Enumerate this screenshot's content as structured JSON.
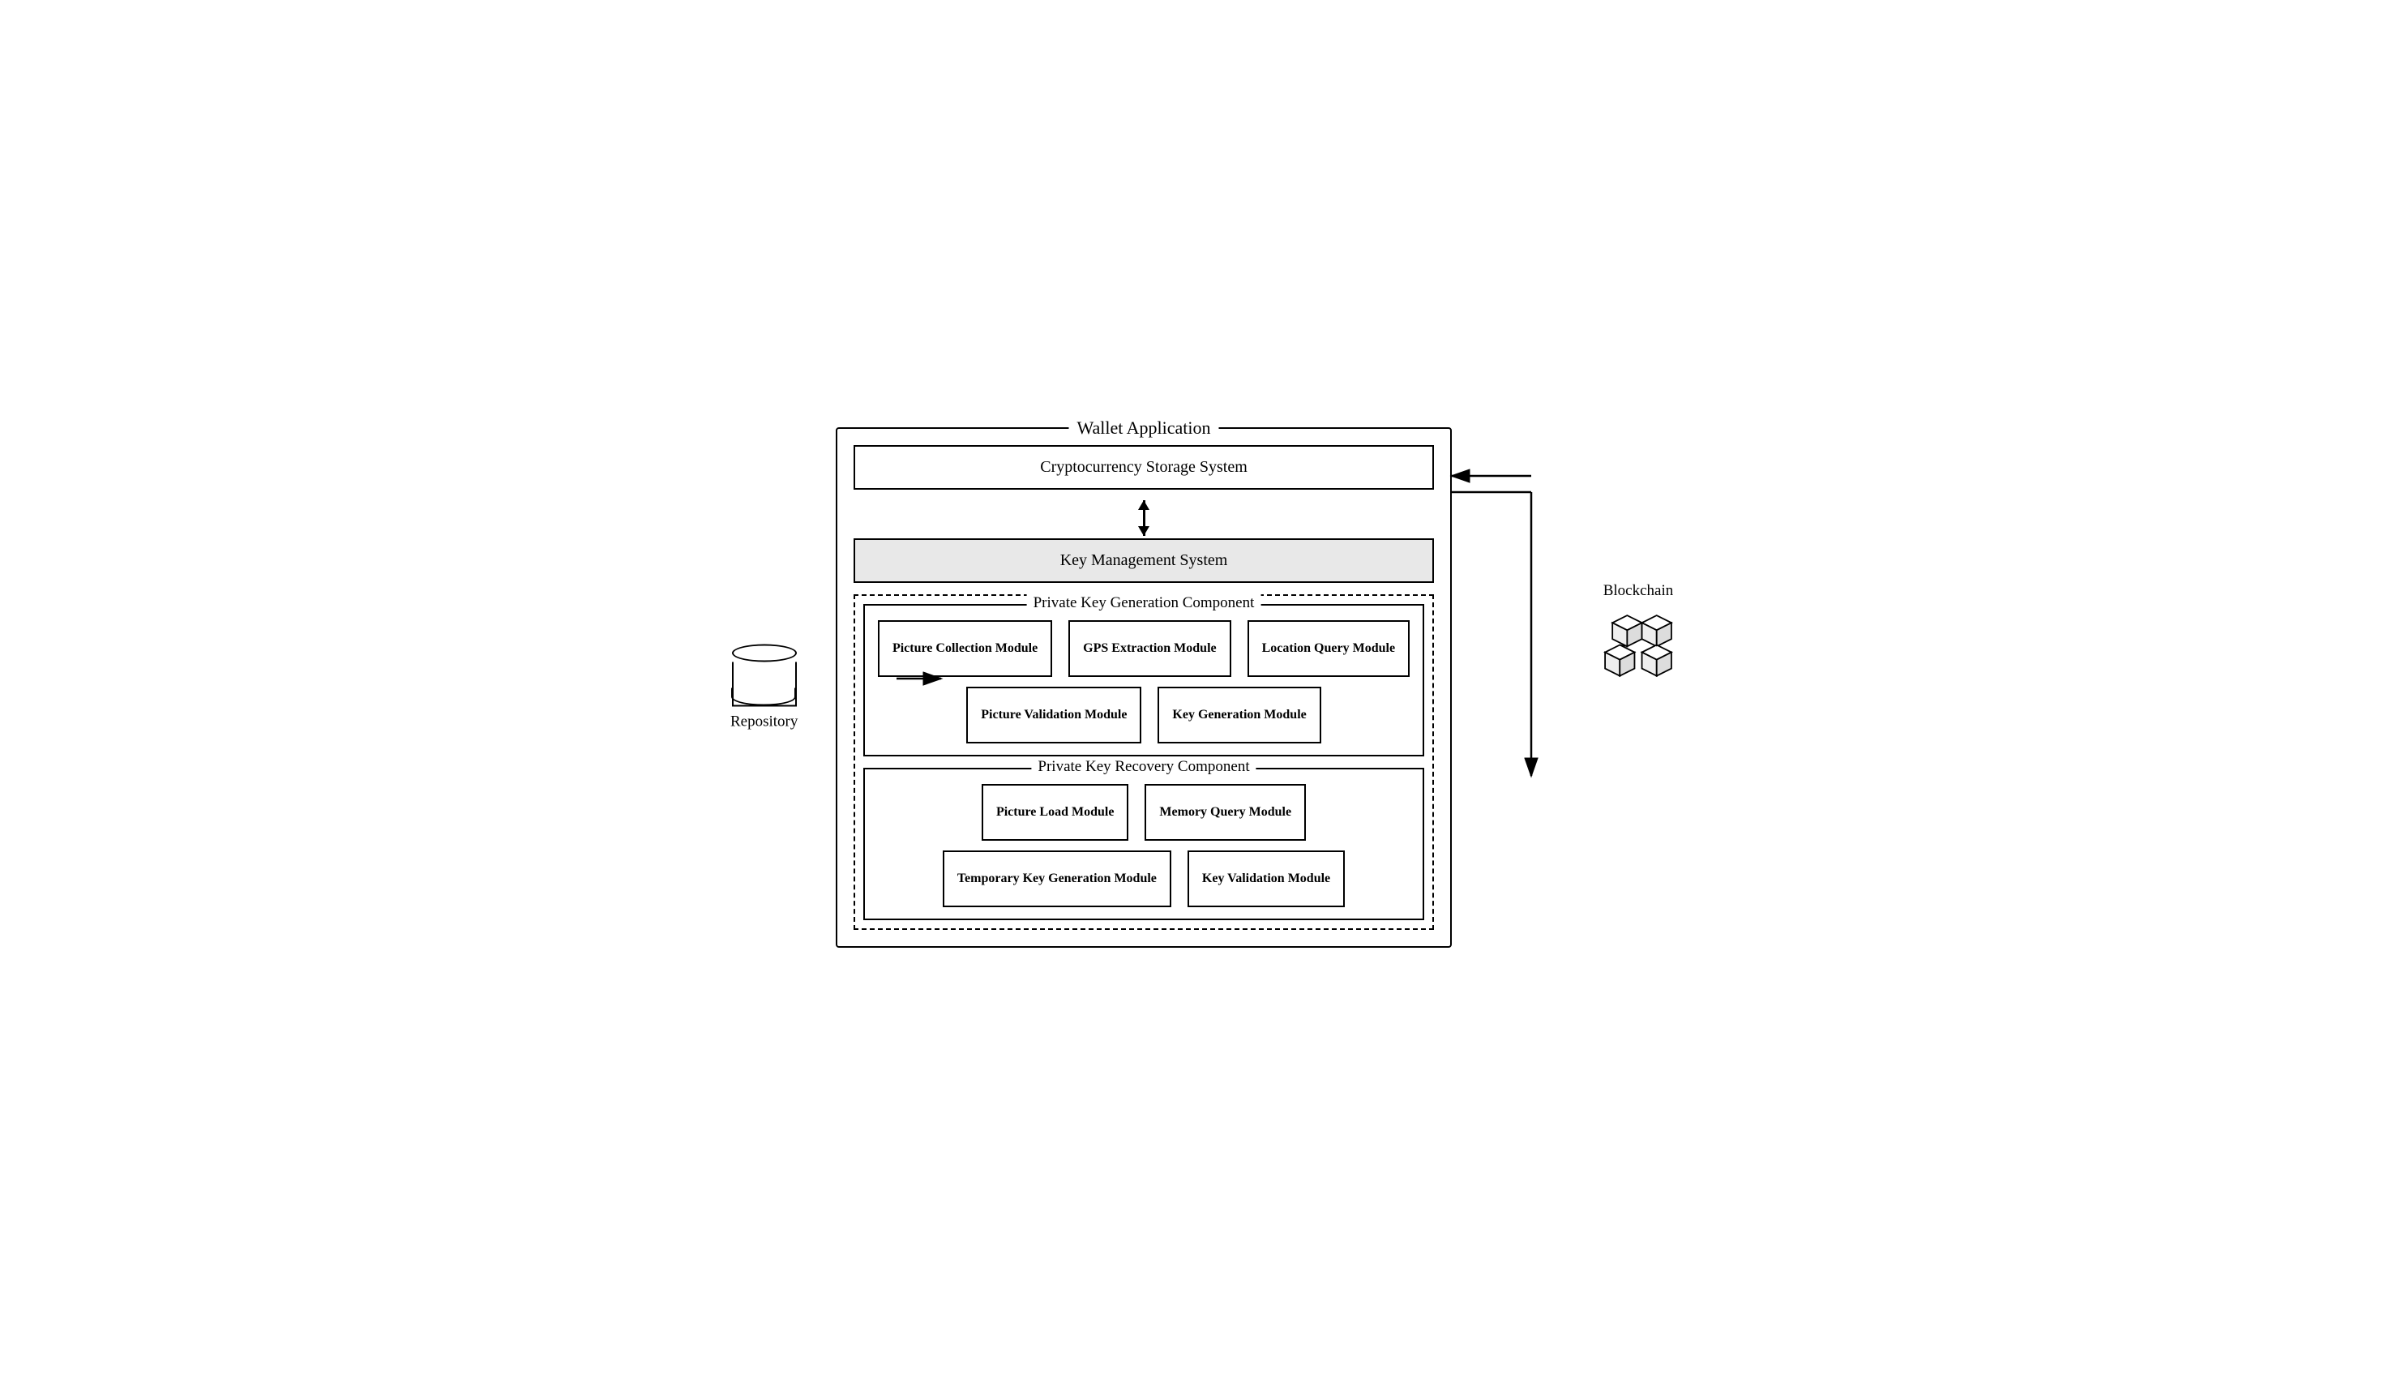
{
  "diagram": {
    "wallet_app_label": "Wallet Application",
    "crypto_storage_label": "Cryptocurrency Storage System",
    "key_management_label": "Key Management System",
    "generation_component_label": "Private Key Generation Component",
    "recovery_component_label": "Private Key Recovery Component",
    "repository_label": "Repository",
    "blockchain_label": "Blockchain",
    "modules": {
      "picture_collection": "Picture Collection Module",
      "gps_extraction": "GPS Extraction Module",
      "location_query": "Location Query Module",
      "picture_validation": "Picture Validation Module",
      "key_generation": "Key Generation Module",
      "picture_load": "Picture Load Module",
      "memory_query": "Memory Query Module",
      "temporary_key_generation": "Temporary Key Generation Module",
      "key_validation": "Key Validation Module"
    }
  }
}
